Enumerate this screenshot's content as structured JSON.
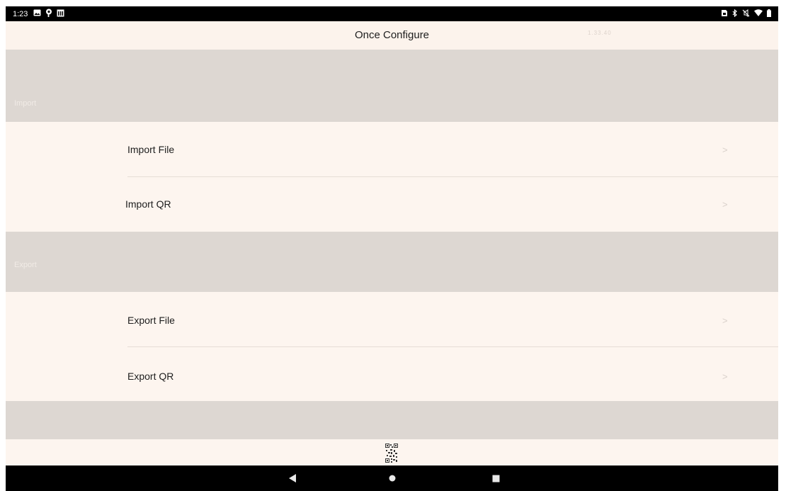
{
  "status_bar": {
    "time": "1:23",
    "left_icons": [
      "image-icon",
      "pinterest-icon",
      "calendar-icon"
    ],
    "right_icons": [
      "sim-icon",
      "bluetooth-icon",
      "mute-icon",
      "wifi-icon",
      "battery-icon"
    ]
  },
  "header": {
    "title": "Once Configure",
    "version": "1.33.40"
  },
  "sections": [
    {
      "label": "Import",
      "items": [
        {
          "label": "Import File",
          "chevron": ">"
        },
        {
          "label": "Import QR",
          "chevron": ">"
        }
      ]
    },
    {
      "label": "Export",
      "items": [
        {
          "label": "Export File",
          "chevron": ">"
        },
        {
          "label": "Export QR",
          "chevron": ">"
        }
      ]
    }
  ],
  "nav_bar": {
    "back_icon": "back-triangle-icon",
    "home_icon": "home-circle-icon",
    "recents_icon": "recents-square-icon"
  },
  "colors": {
    "background": "#fdf5ef",
    "band": "#ddd7d2",
    "status_bar": "#000000",
    "text": "#1e1e1e"
  }
}
